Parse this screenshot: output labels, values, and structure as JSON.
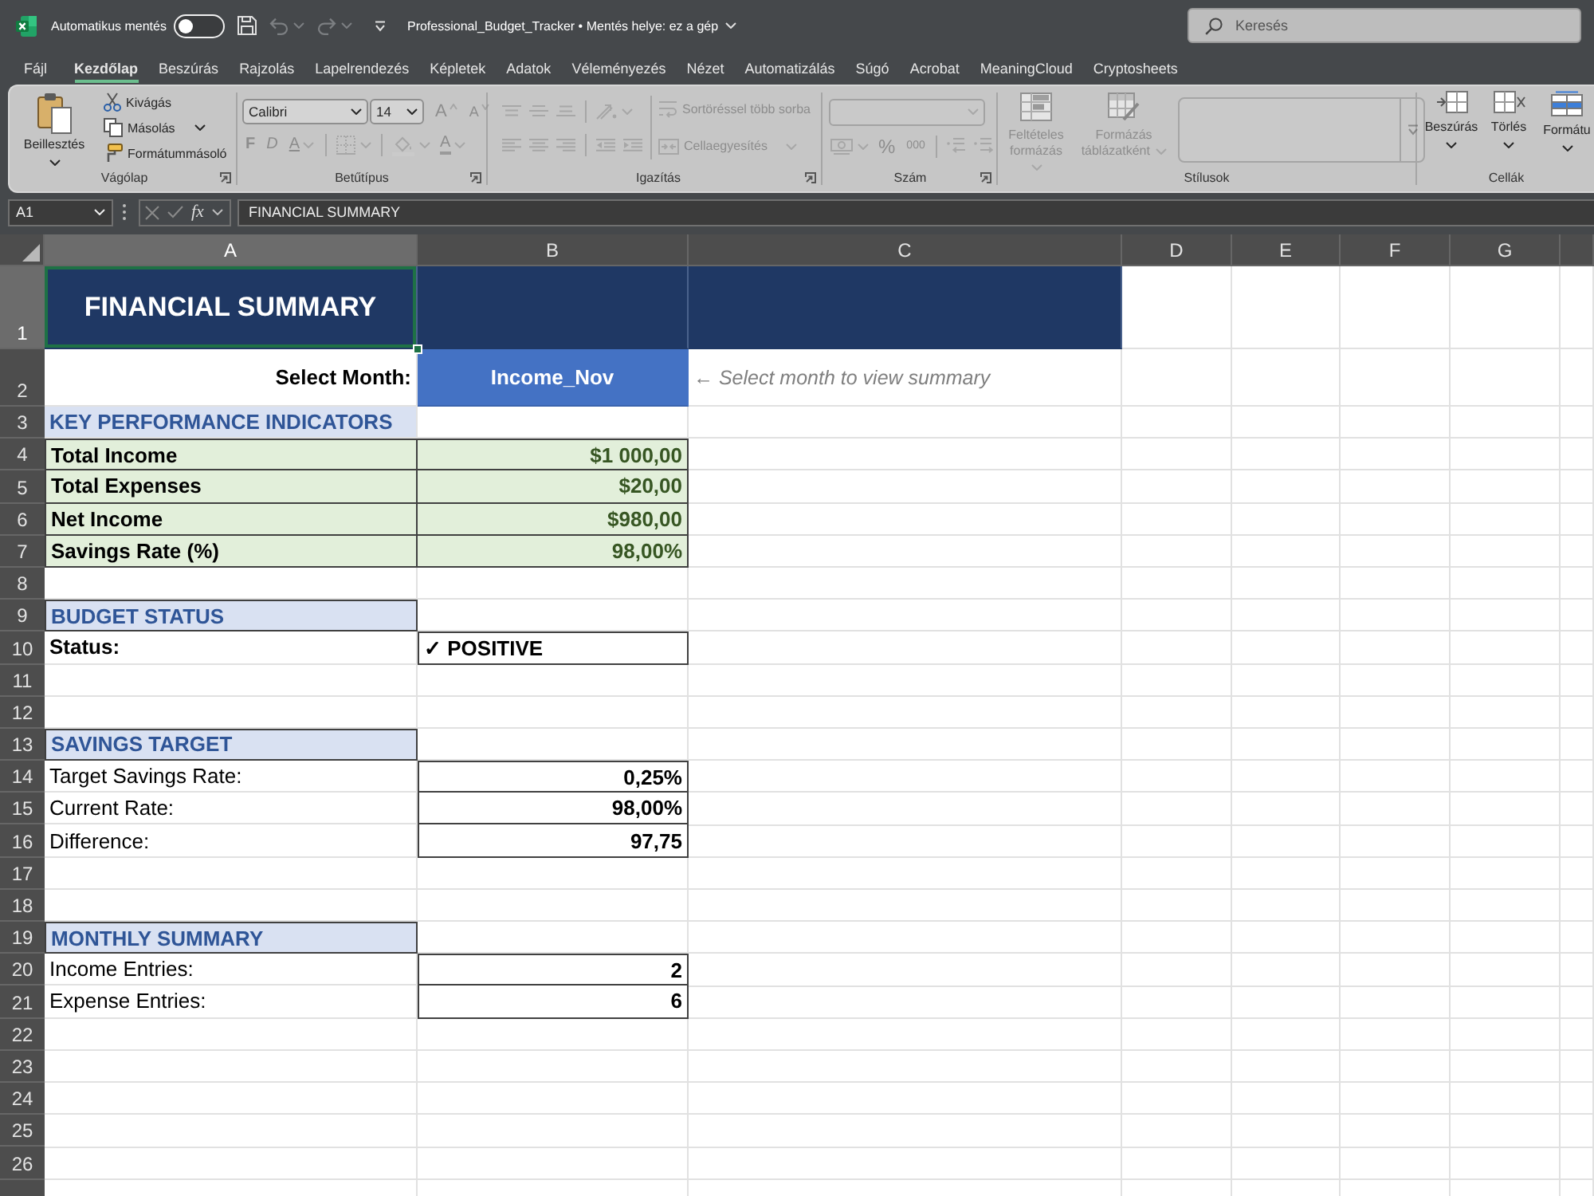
{
  "title_bar": {
    "autosave_label": "Automatikus mentés",
    "autosave_on": false,
    "document_title": "Professional_Budget_Tracker • Mentés helye: ez a gép",
    "search_placeholder": "Keresés"
  },
  "ribbon_tabs": [
    {
      "label": "Fájl",
      "selected": false
    },
    {
      "label": "Kezdőlap",
      "selected": true
    },
    {
      "label": "Beszúrás",
      "selected": false
    },
    {
      "label": "Rajzolás",
      "selected": false
    },
    {
      "label": "Lapelrendezés",
      "selected": false
    },
    {
      "label": "Képletek",
      "selected": false
    },
    {
      "label": "Adatok",
      "selected": false
    },
    {
      "label": "Véleményezés",
      "selected": false
    },
    {
      "label": "Nézet",
      "selected": false
    },
    {
      "label": "Automatizálás",
      "selected": false
    },
    {
      "label": "Súgó",
      "selected": false
    },
    {
      "label": "Acrobat",
      "selected": false
    },
    {
      "label": "MeaningCloud",
      "selected": false
    },
    {
      "label": "Cryptosheets",
      "selected": false
    }
  ],
  "ribbon": {
    "groups": [
      {
        "kind": "clipboard",
        "label": "Vágólap",
        "launcher": true,
        "sections": [
          {
            "lines": [
              {
                "tools": [
                  {
                    "kind": "paste",
                    "label": "Beillesztés",
                    "disabled": false
                  }
                ]
              }
            ]
          },
          {
            "lines": [
              {
                "tools": [
                  {
                    "kind": "cut",
                    "label": "Kivágás",
                    "disabled": false
                  }
                ]
              },
              {
                "tools": [
                  {
                    "kind": "copy",
                    "label": "Másolás",
                    "disabled": false
                  }
                ]
              },
              {
                "tools": [
                  {
                    "kind": "format_painter",
                    "label": "Formátummásoló",
                    "disabled": false
                  }
                ]
              }
            ]
          }
        ]
      },
      {
        "kind": "font",
        "label": "Betűtípus",
        "launcher": true,
        "sections": [
          {
            "lines": [
              {
                "tools": [
                  {
                    "kind": "font_name",
                    "value": "Calibri",
                    "disabled": false
                  },
                  {
                    "kind": "font_size",
                    "value": "14",
                    "disabled": false
                  },
                  {
                    "kind": "grow_font",
                    "label": "A",
                    "disabled": true
                  },
                  {
                    "kind": "shrink_font",
                    "label": "A",
                    "disabled": true
                  }
                ]
              },
              {
                "tools": [
                  {
                    "kind": "bold",
                    "label": "F",
                    "disabled": true
                  },
                  {
                    "kind": "italic",
                    "label": "D",
                    "disabled": true
                  },
                  {
                    "kind": "underline",
                    "label": "A",
                    "disabled": true
                  },
                  {
                    "kind": "separator"
                  },
                  {
                    "kind": "borders",
                    "disabled": true
                  },
                  {
                    "kind": "separator"
                  },
                  {
                    "kind": "fill_color",
                    "disabled": true
                  },
                  {
                    "kind": "font_color",
                    "label": "A",
                    "disabled": true
                  }
                ]
              }
            ]
          }
        ]
      },
      {
        "kind": "alignment",
        "label": "Igazítás",
        "launcher": true,
        "sections": [
          {
            "lines": [
              {
                "tools": [
                  {
                    "kind": "align_top",
                    "disabled": true
                  },
                  {
                    "kind": "align_middle",
                    "disabled": true
                  },
                  {
                    "kind": "align_bottom",
                    "disabled": true
                  },
                  {
                    "kind": "separator"
                  },
                  {
                    "kind": "orientation",
                    "disabled": true
                  }
                ]
              },
              {
                "tools": [
                  {
                    "kind": "align_left",
                    "disabled": true
                  },
                  {
                    "kind": "align_center",
                    "disabled": true
                  },
                  {
                    "kind": "align_right",
                    "disabled": true
                  },
                  {
                    "kind": "separator"
                  },
                  {
                    "kind": "decrease_indent",
                    "disabled": true
                  },
                  {
                    "kind": "increase_indent",
                    "disabled": true
                  }
                ]
              }
            ]
          },
          {
            "lines": [
              {
                "tools": [
                  {
                    "kind": "wrap_text",
                    "label": "Sortöréssel több sorba",
                    "disabled": true
                  }
                ]
              },
              {
                "tools": [
                  {
                    "kind": "merge",
                    "label": "Cellaegyesítés",
                    "disabled": true
                  }
                ]
              }
            ]
          }
        ]
      },
      {
        "kind": "number",
        "label": "Szám",
        "launcher": true,
        "sections": [
          {
            "lines": [
              {
                "tools": [
                  {
                    "kind": "number_format",
                    "disabled": true
                  }
                ]
              },
              {
                "tools": [
                  {
                    "kind": "accounting",
                    "disabled": true
                  },
                  {
                    "kind": "percent",
                    "label": "%",
                    "disabled": true
                  },
                  {
                    "kind": "thousands",
                    "label": "000",
                    "disabled": true
                  },
                  {
                    "kind": "separator"
                  },
                  {
                    "kind": "increase_decimal",
                    "disabled": true
                  },
                  {
                    "kind": "decrease_decimal",
                    "disabled": true
                  }
                ]
              }
            ]
          }
        ]
      },
      {
        "kind": "styles",
        "label": "Stílusok",
        "sections": [
          {
            "lines": [
              {
                "tools": [
                  {
                    "kind": "conditional_formatting",
                    "label": "Feltételes formázás",
                    "disabled": true
                  },
                  {
                    "kind": "format_as_table",
                    "label": "Formázás táblázatként",
                    "disabled": true
                  },
                  {
                    "kind": "style_gallery",
                    "disabled": true
                  }
                ]
              }
            ]
          }
        ]
      },
      {
        "kind": "cells",
        "label": "Cellák",
        "sections": [
          {
            "lines": [
              {
                "tools": [
                  {
                    "kind": "insert_cells",
                    "label": "Beszúrás",
                    "disabled": false
                  },
                  {
                    "kind": "delete_cells",
                    "label": "Törlés",
                    "disabled": false
                  },
                  {
                    "kind": "format_cells",
                    "label": "Formátu",
                    "disabled": false
                  }
                ]
              }
            ]
          }
        ]
      }
    ]
  },
  "formula_bar": {
    "name_box": "A1",
    "function_label": "fx",
    "formula": "FINANCIAL SUMMARY"
  },
  "sheet": {
    "columns": [
      "A",
      "B",
      "C",
      "D",
      "E",
      "F",
      "G"
    ],
    "rows": [
      {
        "number": "1",
        "cells": [
          {
            "kind": "title",
            "text": "FINANCIAL SUMMARY",
            "selected": true
          },
          {
            "kind": "title",
            "selected": false
          },
          {
            "kind": "title",
            "selected": false
          }
        ]
      },
      {
        "number": "2",
        "cells": [
          {
            "kind": "prompt",
            "text": "Select Month:",
            "selected": false
          },
          {
            "kind": "dropdown",
            "text": "Income_Nov",
            "selected": false
          },
          {
            "kind": "hint",
            "text": "← Select month to view summary",
            "selected": false
          }
        ]
      },
      {
        "number": "3",
        "cells": [
          {
            "kind": "section",
            "text": "KEY PERFORMANCE INDICATORS",
            "selected": false
          }
        ]
      },
      {
        "number": "4",
        "cells": [
          {
            "kind": "kpi_label",
            "text": "Total Income",
            "selected": false
          },
          {
            "kind": "kpi_value",
            "text": "$1 000,00",
            "selected": false
          }
        ]
      },
      {
        "number": "5",
        "cells": [
          {
            "kind": "kpi_label",
            "text": "Total Expenses",
            "selected": false
          },
          {
            "kind": "kpi_value",
            "text": "$20,00",
            "selected": false
          }
        ]
      },
      {
        "number": "6",
        "cells": [
          {
            "kind": "kpi_label",
            "text": "Net Income",
            "selected": false
          },
          {
            "kind": "kpi_value",
            "text": "$980,00",
            "selected": false
          }
        ]
      },
      {
        "number": "7",
        "cells": [
          {
            "kind": "kpi_label",
            "text": "Savings Rate (%)",
            "selected": false
          },
          {
            "kind": "kpi_value",
            "text": "98,00%",
            "selected": false
          }
        ]
      },
      {
        "number": "8"
      },
      {
        "number": "9",
        "cells": [
          {
            "kind": "section_boxed",
            "text": "BUDGET STATUS",
            "selected": false
          }
        ]
      },
      {
        "number": "10",
        "cells": [
          {
            "kind": "label_bold",
            "text": "Status:",
            "selected": false
          },
          {
            "kind": "status",
            "text": "✓ POSITIVE",
            "selected": false
          }
        ]
      },
      {
        "number": "11"
      },
      {
        "number": "12"
      },
      {
        "number": "13",
        "cells": [
          {
            "kind": "section_boxed",
            "text": "SAVINGS TARGET",
            "selected": false
          }
        ]
      },
      {
        "number": "14",
        "cells": [
          {
            "kind": "label",
            "text": "Target Savings Rate:",
            "selected": false
          },
          {
            "kind": "value",
            "text": "0,25%",
            "selected": false
          }
        ]
      },
      {
        "number": "15",
        "cells": [
          {
            "kind": "label",
            "text": "Current Rate:",
            "selected": false
          },
          {
            "kind": "value",
            "text": "98,00%",
            "selected": false
          }
        ]
      },
      {
        "number": "16",
        "cells": [
          {
            "kind": "label",
            "text": "Difference:",
            "selected": false
          },
          {
            "kind": "value",
            "text": "97,75",
            "selected": false
          }
        ]
      },
      {
        "number": "17"
      },
      {
        "number": "18"
      },
      {
        "number": "19",
        "cells": [
          {
            "kind": "section_boxed",
            "text": "MONTHLY SUMMARY",
            "selected": false
          }
        ]
      },
      {
        "number": "20",
        "cells": [
          {
            "kind": "label",
            "text": "Income Entries:",
            "selected": false
          },
          {
            "kind": "value",
            "text": "2",
            "selected": false
          }
        ]
      },
      {
        "number": "21",
        "cells": [
          {
            "kind": "label",
            "text": "Expense Entries:",
            "selected": false
          },
          {
            "kind": "value",
            "text": "6",
            "selected": false
          }
        ]
      },
      {
        "number": "22"
      },
      {
        "number": "23"
      },
      {
        "number": "24"
      },
      {
        "number": "25"
      },
      {
        "number": "26"
      }
    ]
  }
}
